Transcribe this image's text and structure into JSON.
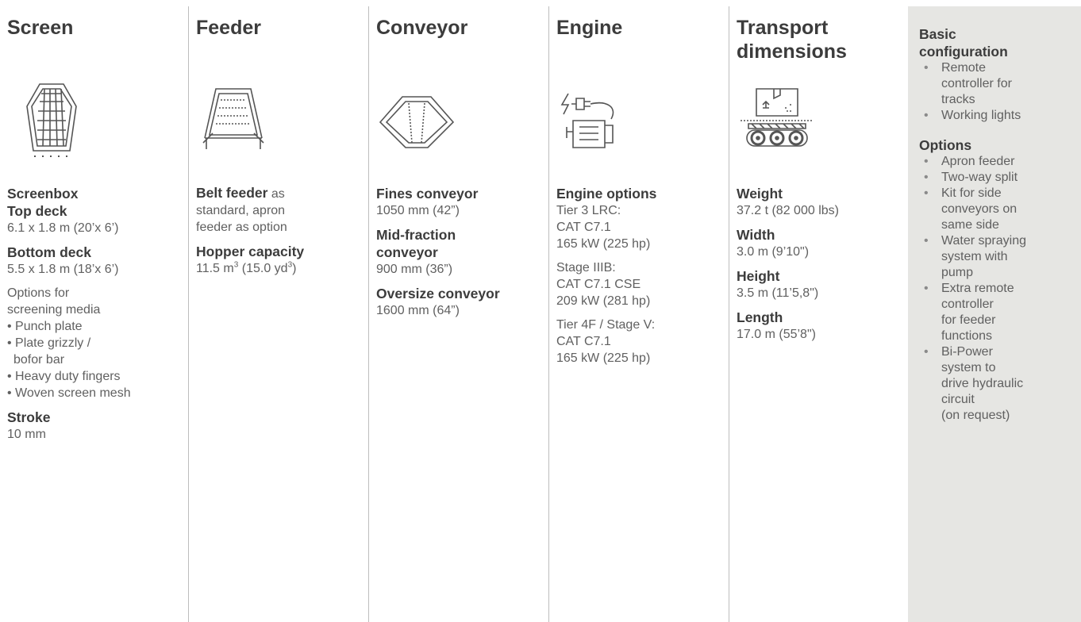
{
  "screen": {
    "title": "Screen",
    "screenbox_label": "Screenbox",
    "top_deck_label": "Top deck",
    "top_deck_value": "6.1 x 1.8 m (20’x 6’)",
    "bottom_deck_label": "Bottom deck",
    "bottom_deck_value": "5.5 x 1.8 m (18’x 6’)",
    "options_line1": "Options for",
    "options_line2": "screening media",
    "media": [
      "• Punch plate",
      "• Plate grizzly /",
      "bofor bar",
      "• Heavy duty fingers",
      "• Woven screen mesh"
    ],
    "stroke_label": "Stroke",
    "stroke_value": "10 mm"
  },
  "feeder": {
    "title": "Feeder",
    "belt_bold": "Belt feeder",
    "belt_rest1": " as",
    "belt_line2": "standard, apron",
    "belt_line3": "feeder as option",
    "hopper_label": "Hopper capacity",
    "hopper_a": "11.5 m",
    "hopper_sup1": "3",
    "hopper_b": " (15.0 yd",
    "hopper_sup2": "3",
    "hopper_c": ")"
  },
  "conveyor": {
    "title": "Conveyor",
    "fines_label": "Fines conveyor",
    "fines_value": "1050 mm (42”)",
    "mid_label1": "Mid-fraction",
    "mid_label2": "conveyor",
    "mid_value": "900 mm (36”)",
    "over_label": "Oversize conveyor",
    "over_value": "1600 mm (64”)"
  },
  "engine": {
    "title": "Engine",
    "options_label": "Engine options",
    "tier3": [
      "Tier 3 LRC:",
      "CAT C7.1",
      "165 kW (225 hp)"
    ],
    "stage3b": [
      "Stage IIIB:",
      "CAT C7.1 CSE",
      "209 kW (281 hp)"
    ],
    "tier4": [
      "Tier 4F / Stage V:",
      "CAT C7.1",
      "165 kW (225 hp)"
    ]
  },
  "transport": {
    "title1": "Transport",
    "title2": "dimensions",
    "weight_label": "Weight",
    "weight_value": "37.2 t (82 000 lbs)",
    "width_label": "Width",
    "width_value": "3.0 m (9’10\")",
    "height_label": "Height",
    "height_value": "3.5 m (11’5,8\")",
    "length_label": "Length",
    "length_value": "17.0 m (55’8\")"
  },
  "aside": {
    "basic_title1": "Basic",
    "basic_title2": "configuration",
    "basic_items": [
      [
        "Remote",
        "controller for",
        "tracks"
      ],
      [
        "Working lights"
      ]
    ],
    "options_title": "Options",
    "option_items": [
      [
        "Apron feeder"
      ],
      [
        "Two-way split"
      ],
      [
        "Kit for side",
        "conveyors on",
        "same side"
      ],
      [
        "Water spraying",
        "system with",
        "pump"
      ],
      [
        "Extra remote",
        "controller",
        "for feeder",
        "functions"
      ],
      [
        "Bi-Power",
        "system to",
        "drive hydraulic",
        "circuit",
        "(on request)"
      ]
    ],
    "bullet": "•"
  },
  "colors": {
    "panel_bg": "#e6e6e3",
    "heading": "#3c3c3c",
    "text": "#606060",
    "divider": "#bdbdbd"
  }
}
